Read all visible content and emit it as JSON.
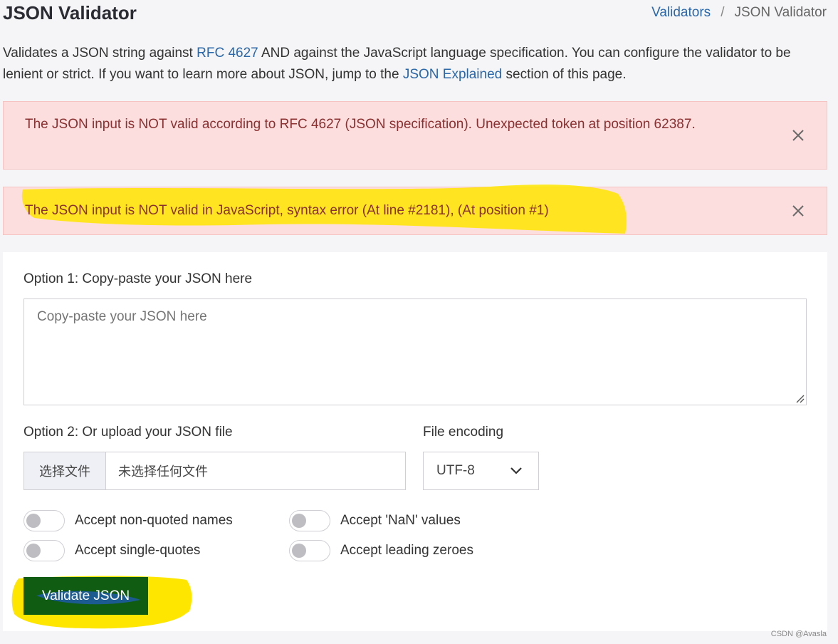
{
  "header": {
    "title": "JSON Validator",
    "breadcrumb": [
      {
        "label": "Validators",
        "link": true
      },
      {
        "label": "JSON Validator",
        "link": false
      }
    ],
    "breadcrumb_separator": "/"
  },
  "intro": {
    "part1": "Validates a JSON string against ",
    "link1": "RFC 4627",
    "part2": " AND against the JavaScript language specification. You can configure the validator to be lenient or strict. If you want to learn more about JSON, jump to the ",
    "link2": "JSON Explained",
    "part3": " section of this page."
  },
  "alerts": [
    {
      "text": "The JSON input is NOT valid according to RFC 4627 (JSON specification). Unexpected token at position 62387."
    },
    {
      "text": "The JSON input is NOT valid in JavaScript, syntax error (At line #2181), (At position #1)"
    }
  ],
  "form": {
    "option1_label": "Option 1: Copy-paste your JSON here",
    "textarea_placeholder": "Copy-paste your JSON here",
    "option2_label": "Option 2: Or upload your JSON file",
    "file_button": "选择文件",
    "file_status": "未选择任何文件",
    "encoding_label": "File encoding",
    "encoding_value": "UTF-8",
    "toggles": [
      {
        "label": "Accept non-quoted names",
        "on": false
      },
      {
        "label": "Accept 'NaN' values",
        "on": false
      },
      {
        "label": "Accept single-quotes",
        "on": false
      },
      {
        "label": "Accept leading zeroes",
        "on": false
      }
    ],
    "submit": "Validate JSON"
  },
  "colors": {
    "accent_link": "#2a67a8",
    "alert_bg": "#fddede",
    "alert_text": "#8a3030",
    "highlight": "#ffe600",
    "button_bg": "#0f5c12"
  },
  "watermark": "CSDN @Avasla"
}
